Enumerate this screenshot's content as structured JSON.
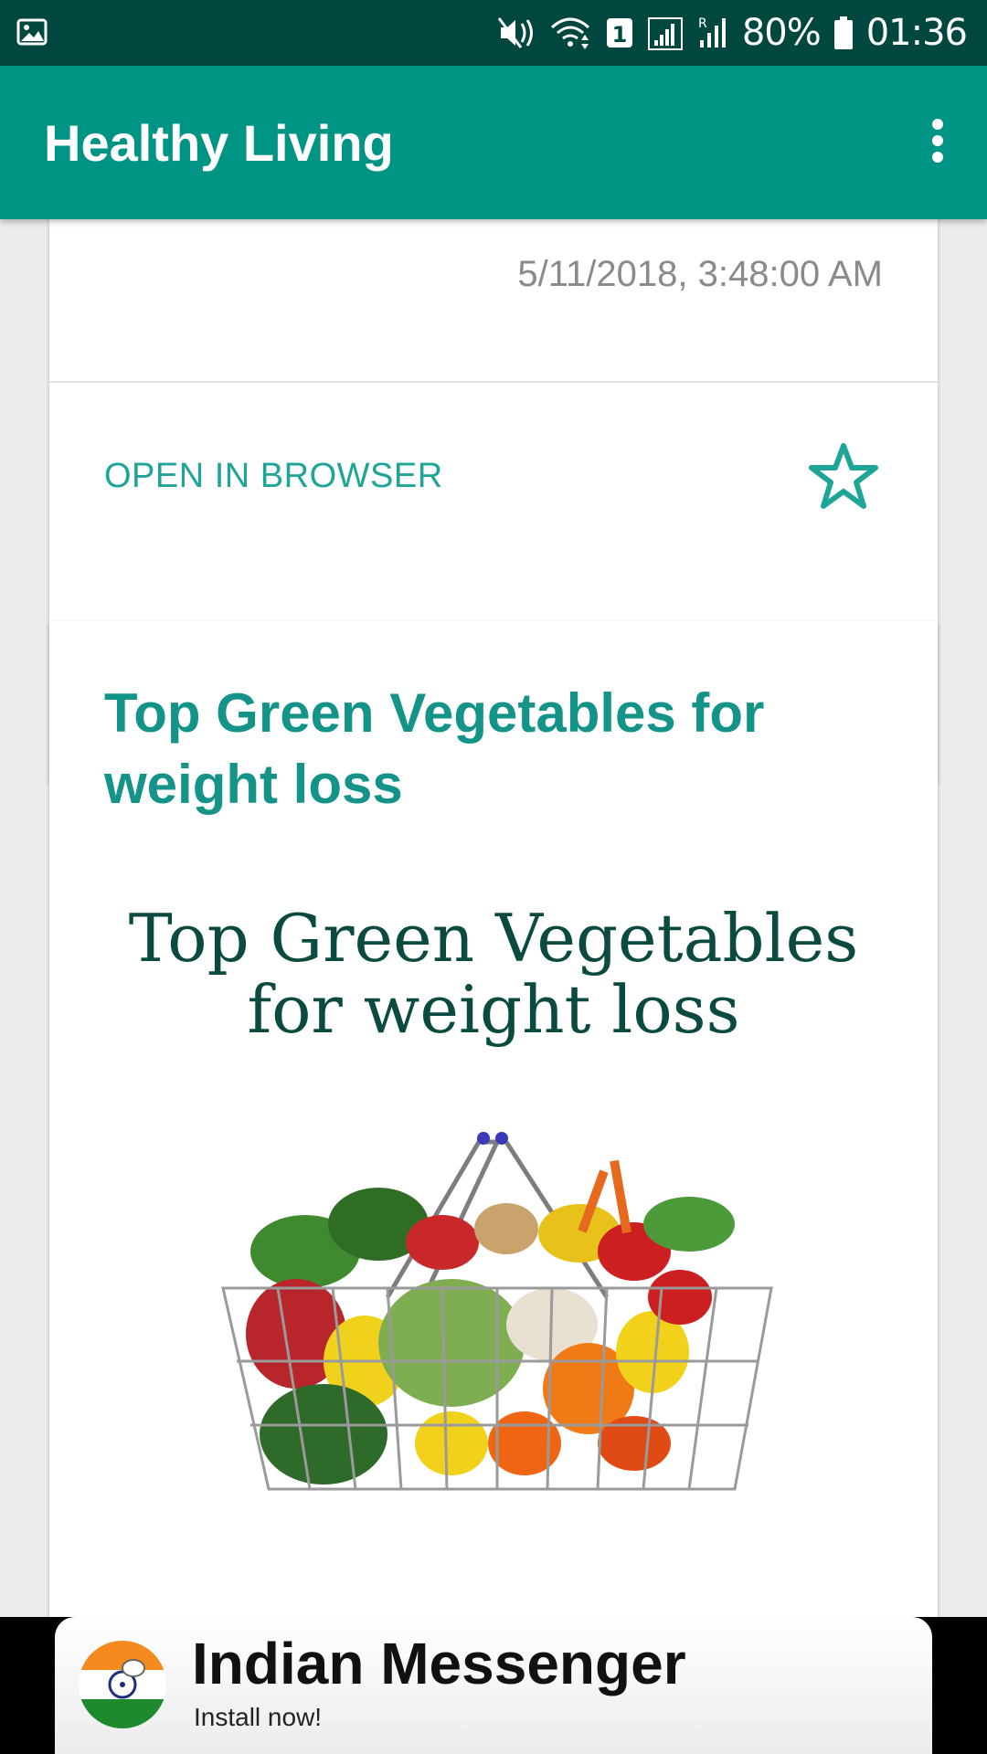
{
  "status_bar": {
    "battery_text": "80%",
    "clock": "01:36",
    "sim_badge": "1",
    "icons": [
      "image-icon",
      "mute-icon",
      "wifi-icon",
      "sim-icon",
      "signal-icon",
      "roaming-signal-icon",
      "battery-icon"
    ]
  },
  "app_bar": {
    "title": "Healthy Living",
    "menu_icon": "more-vert-icon"
  },
  "cards": [
    {
      "date": "5/11/2018, 3:48:00 AM",
      "action_label": "OPEN IN BROWSER",
      "favorite_icon": "star-outline-icon"
    },
    {
      "title": "Top Green Vegetables for weight loss",
      "heading": "Top Green Vegetables for weight loss",
      "image": "vegetable-basket-image"
    }
  ],
  "ad": {
    "title": "Indian Messenger",
    "subtitle": "Install now!"
  },
  "colors": {
    "status_bar": "#00473f",
    "app_bar": "#009485",
    "accent": "#1fa597",
    "article_title": "#149488",
    "article_heading": "#0b4a40"
  }
}
